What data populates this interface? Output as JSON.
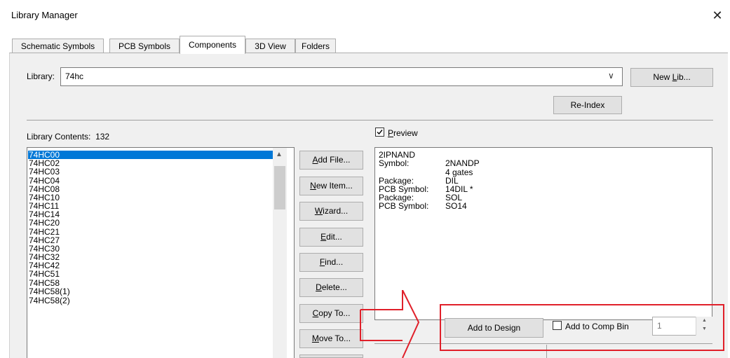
{
  "window": {
    "title": "Library Manager",
    "close_glyph": "✕"
  },
  "tabs": [
    {
      "label": "Schematic Symbols",
      "active": false
    },
    {
      "label": "PCB Symbols",
      "active": false
    },
    {
      "label": "Components",
      "active": true
    },
    {
      "label": "3D View",
      "active": false
    },
    {
      "label": "Folders",
      "active": false
    }
  ],
  "library": {
    "label": "Library:",
    "value": "74hc",
    "dropdown_glyph": "∨",
    "new_lib_button": {
      "pre": "New ",
      "accel": "L",
      "post": "ib..."
    },
    "reindex_button": "Re-Index"
  },
  "contents": {
    "label": "Library Contents:",
    "count": "132",
    "items": [
      "74HC00",
      "74HC02",
      "74HC03",
      "74HC04",
      "74HC08",
      "74HC10",
      "74HC11",
      "74HC14",
      "74HC20",
      "74HC21",
      "74HC27",
      "74HC30",
      "74HC32",
      "74HC42",
      "74HC51",
      "74HC58",
      "74HC58(1)",
      "74HC58(2)"
    ],
    "selected_index": 0,
    "scroll_up_glyph": "▲"
  },
  "actions": [
    {
      "pre": "",
      "accel": "A",
      "post": "dd File..."
    },
    {
      "pre": "",
      "accel": "N",
      "post": "ew Item..."
    },
    {
      "pre": "",
      "accel": "W",
      "post": "izard..."
    },
    {
      "pre": "",
      "accel": "E",
      "post": "dit..."
    },
    {
      "pre": "",
      "accel": "F",
      "post": "ind..."
    },
    {
      "pre": "",
      "accel": "D",
      "post": "elete..."
    },
    {
      "pre": "",
      "accel": "C",
      "post": "opy To..."
    },
    {
      "pre": "",
      "accel": "M",
      "post": "ove To..."
    }
  ],
  "preview": {
    "checkbox_checked": true,
    "label": {
      "pre": "",
      "accel": "P",
      "post": "review"
    },
    "component_name": "2IPNAND",
    "rows": [
      {
        "key": "Symbol:",
        "value": "2NANDP"
      },
      {
        "key": "",
        "value": "4 gates"
      },
      {
        "key": "Package:",
        "value": "DIL"
      },
      {
        "key": "PCB Symbol:",
        "value": "14DIL *"
      },
      {
        "key": "Package:",
        "value": "SOL"
      },
      {
        "key": "PCB Symbol:",
        "value": "SO14"
      }
    ]
  },
  "add_to_design_button": "Add to Design",
  "add_to_comp_bin": {
    "label": "Add to Comp Bin",
    "checked": false
  },
  "quantity": {
    "value": "1",
    "up_glyph": "▲",
    "down_glyph": "▼"
  },
  "colors": {
    "selection": "#0078d7",
    "highlight": "#e0202a"
  }
}
